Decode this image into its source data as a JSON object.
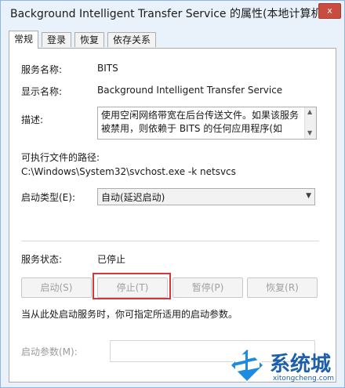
{
  "window": {
    "title": "Background Intelligent Transfer Service 的属性(本地计算机)",
    "close": "x"
  },
  "tabs": [
    {
      "label": "常规",
      "active": true
    },
    {
      "label": "登录"
    },
    {
      "label": "恢复"
    },
    {
      "label": "依存关系"
    }
  ],
  "general": {
    "service_name_label": "服务名称:",
    "service_name": "BITS",
    "display_name_label": "显示名称:",
    "display_name": "Background Intelligent Transfer Service",
    "description_label": "描述:",
    "description": "使用空闲网络带宽在后台传送文件。如果该服务被禁用，则依赖于 BITS 的任何应用程序(如 Windows 更新",
    "path_label": "可执行文件的路径:",
    "path": "C:\\Windows\\System32\\svchost.exe -k netsvcs",
    "startup_type_label": "启动类型(E):",
    "startup_type": "自动(延迟启动)",
    "status_label": "服务状态:",
    "status": "已停止",
    "buttons": {
      "start": "启动(S)",
      "stop": "停止(T)",
      "pause": "暂停(P)",
      "resume": "恢复(R)"
    },
    "hint": "当从此处启动服务时，你可指定所适用的启动参数。",
    "params_label": "启动参数(M):"
  },
  "watermark": {
    "text": "系统城",
    "sub": "xitongcheng.com"
  },
  "colors": {
    "highlight": "#d73737",
    "window_bg": "#e9f2fb",
    "logo": "#1d5fa8"
  }
}
